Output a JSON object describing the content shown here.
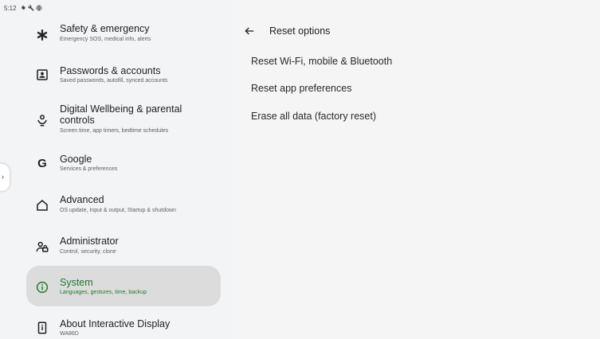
{
  "status_bar": {
    "time": "5:12"
  },
  "sidebar": {
    "items": [
      {
        "title": "Safety & emergency",
        "subtitle": "Emergency SOS, medical info, alerts",
        "icon": "asterisk-icon"
      },
      {
        "title": "Passwords & accounts",
        "subtitle": "Saved passwords, autofill, synced accounts",
        "icon": "account-box-icon"
      },
      {
        "title": "Digital Wellbeing & parental controls",
        "subtitle": "Screen time, app timers, bedtime schedules",
        "icon": "wellbeing-icon"
      },
      {
        "title": "Google",
        "subtitle": "Services & preferences",
        "icon": "google-icon"
      },
      {
        "title": "Advanced",
        "subtitle": "OS update, Input & output, Startup & shutdown",
        "icon": "home-outline-icon"
      },
      {
        "title": "Administrator",
        "subtitle": "Control, security, clone",
        "icon": "admin-icon"
      },
      {
        "title": "System",
        "subtitle": "Languages, gestures, time, backup",
        "icon": "info-icon",
        "selected": true
      },
      {
        "title": "About Interactive Display",
        "subtitle": "WA86D",
        "icon": "device-info-icon"
      }
    ]
  },
  "main": {
    "title": "Reset options",
    "options": [
      "Reset Wi-Fi, mobile & Bluetooth",
      "Reset app preferences",
      "Erase all data (factory reset)"
    ]
  },
  "colors": {
    "accent": "#1f7a2f",
    "selected_bg": "#dcdcdc"
  }
}
